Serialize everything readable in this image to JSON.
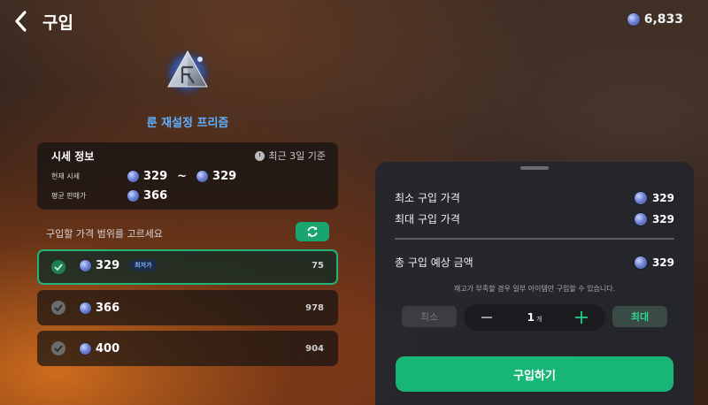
{
  "header": {
    "title": "구입",
    "currency_amount": "6,833",
    "back_icon": "chevron-left-icon",
    "currency_icon": "blue-coin-icon"
  },
  "item": {
    "name": "룬 재설정 프리즘",
    "icon": "rune-prism-icon"
  },
  "market": {
    "title": "시세 정보",
    "basis": "최근 3일 기준",
    "current_label": "현재 시세",
    "current_min": "329",
    "current_max": "329",
    "range_sep": "~",
    "avg_label": "평균 판매가",
    "avg_value": "366"
  },
  "range": {
    "label": "구입할 가격 범위를 고르세요",
    "options": [
      {
        "price": "329",
        "badge": "최저가",
        "qty": "75",
        "selected": true
      },
      {
        "price": "366",
        "badge": "",
        "qty": "978",
        "selected": false
      },
      {
        "price": "400",
        "badge": "",
        "qty": "904",
        "selected": false
      }
    ]
  },
  "panel": {
    "min_price_label": "최소 구입 가격",
    "min_price_value": "329",
    "max_price_label": "최대 구입 가격",
    "max_price_value": "329",
    "total_label": "총 구입 예상 금액",
    "total_value": "329",
    "notice": "재고가 부족할 경우 일부 아이템만 구입할 수 있습니다.",
    "min_button": "최소",
    "quantity": "1",
    "quantity_unit": "개",
    "max_button": "최대",
    "buy_button": "구입하기"
  },
  "colors": {
    "accent_green": "#17b676",
    "item_name_blue": "#5fb0ff",
    "badge_blue": "#7fb4ff"
  }
}
